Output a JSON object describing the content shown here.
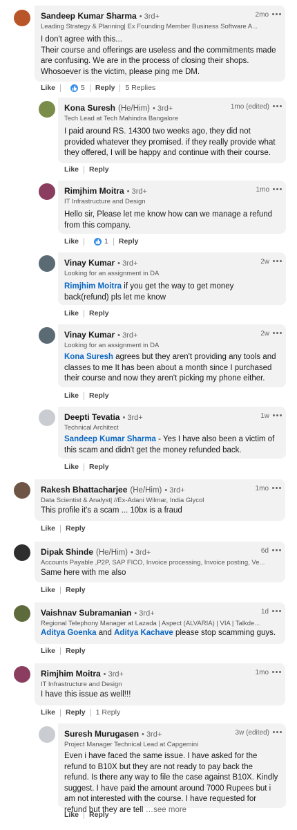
{
  "comments": [
    {
      "name": "Sandeep Kumar Sharma",
      "degree": "• 3rd+",
      "pronouns": "",
      "subtitle": "Leading Strategy & Planning| Ex Founding Member Business Software A...",
      "time": "2mo",
      "body": "I don't agree with this...\nTheir course and offerings are useless and the commitments made are confusing. We are in the process of closing their shops. Whosoever is the victim, please ping me DM.",
      "like": "Like",
      "reaction_count": "5",
      "reply": "Reply",
      "replies_count": "5 Replies",
      "avatar_color": "#b8562a"
    },
    {
      "name": "Kona Suresh",
      "pronouns": "(He/Him)",
      "degree": "• 3rd+",
      "subtitle": "Tech Lead at Tech Mahindra Bangalore",
      "time": "1mo (edited)",
      "body": "I paid around RS. 14300 two weeks ago, they did not provided whatever they promised. if they really provide what they offered, I will be happy and continue with their course.",
      "like": "Like",
      "reply": "Reply",
      "avatar_color": "#7a8c4a"
    },
    {
      "name": "Rimjhim Moitra",
      "pronouns": "",
      "degree": "• 3rd+",
      "subtitle": "IT Infrastructure and Design",
      "time": "1mo",
      "body": "Hello sir, Please let me know how can we manage a refund from this company.",
      "like": "Like",
      "reaction_count": "1",
      "reply": "Reply",
      "avatar_color": "#8a3d5e"
    },
    {
      "name": "Vinay Kumar",
      "pronouns": "",
      "degree": "• 3rd+",
      "subtitle": "Looking for an assignment in DA",
      "time": "2w",
      "mention": "Rimjhim Moitra",
      "body": " if you get the way to get money back(refund) pls let me know",
      "like": "Like",
      "reply": "Reply",
      "avatar_color": "#5a6b74"
    },
    {
      "name": "Vinay Kumar",
      "pronouns": "",
      "degree": "• 3rd+",
      "subtitle": "Looking for an assignment in DA",
      "time": "2w",
      "mention": "Kona Suresh",
      "body": " agrees but they aren't providing any tools and classes to me It has been about a month since I purchased their course and now they aren't picking my phone either.",
      "like": "Like",
      "reply": "Reply",
      "avatar_color": "#5a6b74"
    },
    {
      "name": "Deepti Tevatia",
      "pronouns": "",
      "degree": "• 3rd+",
      "subtitle": "Technical Architect",
      "time": "1w",
      "mention": "Sandeep Kumar Sharma",
      "body": " - Yes I have also been a victim of this scam and didn't get the money refunded back.",
      "like": "Like",
      "reply": "Reply",
      "avatar_color": "#c9cdd2"
    },
    {
      "name": "Rakesh Bhattacharjee",
      "pronouns": "(He/Him)",
      "degree": "• 3rd+",
      "subtitle": "Data Scientist & Analyst| //Ex-Adani Wilmar, India Glycol",
      "time": "1mo",
      "body": "This profile it's a scam ... 10bx is a fraud",
      "like": "Like",
      "reply": "Reply",
      "avatar_color": "#6f5546"
    },
    {
      "name": "Dipak Shinde",
      "pronouns": "(He/Him)",
      "degree": "• 3rd+",
      "subtitle": "Accounts Payable ,P2P, SAP FICO, Invoice processing, Invoice posting, Ve...",
      "time": "6d",
      "body": "Same here with me also",
      "like": "Like",
      "reply": "Reply",
      "avatar_color": "#2e2e2e"
    },
    {
      "name": "Vaishnav Subramanian",
      "pronouns": "",
      "degree": "• 3rd+",
      "subtitle": "Regional Telephony Manager at Lazada | Aspect (ALVARIA) | VIA | Talkde...",
      "time": "1d",
      "mention": "Aditya Goenka",
      "mid": " and ",
      "mention2": "Aditya Kachave",
      "body": " please stop scamming guys.",
      "like": "Like",
      "reply": "Reply",
      "avatar_color": "#5d6a3c"
    },
    {
      "name": "Rimjhim Moitra",
      "pronouns": "",
      "degree": "• 3rd+",
      "subtitle": "IT Infrastructure and Design",
      "time": "1mo",
      "body": "I have this issue as well!!!",
      "like": "Like",
      "reply": "Reply",
      "replies_count": "1 Reply",
      "avatar_color": "#8a3d5e"
    },
    {
      "name": "Suresh Murugasen",
      "pronouns": "",
      "degree": "• 3rd+",
      "subtitle": "Project Manager Technical Lead at Capgemini",
      "time": "3w (edited)",
      "body": "Even i have faced the same issue. I have asked for the refund to B10X but they are not ready to pay back the refund. Is there any way to file the case against B10X. Kindly suggest. I have paid the amount around 7000 Rupees but i am not interested with the course. I have requested for refund but they are tell ",
      "see_more": "…see more",
      "like": "Like",
      "reply": "Reply",
      "avatar_color": "#c9cdd2"
    }
  ]
}
